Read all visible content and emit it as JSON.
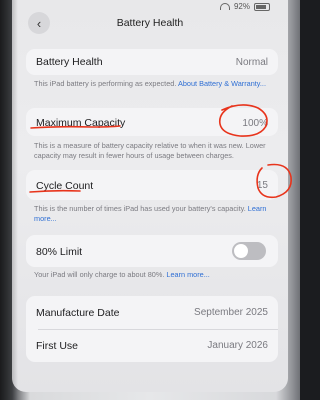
{
  "status": {
    "battery_text": "92%"
  },
  "nav": {
    "back_glyph": "‹",
    "title": "Battery Health"
  },
  "battery_health": {
    "label": "Battery Health",
    "value": "Normal",
    "note": "This iPad battery is performing as expected.",
    "link": "About Battery & Warranty..."
  },
  "max_capacity": {
    "label": "Maximum Capacity",
    "value": "100%",
    "note": "This is a measure of battery capacity relative to when it was new. Lower capacity may result in fewer hours of usage between charges."
  },
  "cycle_count": {
    "label": "Cycle Count",
    "value": "15",
    "note": "This is the number of times iPad has used your battery's capacity.",
    "link": "Learn more..."
  },
  "limit": {
    "label": "80% Limit",
    "enabled": false,
    "note": "Your iPad will only charge to about 80%.",
    "link": "Learn more..."
  },
  "dates": {
    "manufacture_label": "Manufacture Date",
    "manufacture_value": "September 2025",
    "first_use_label": "First Use",
    "first_use_value": "January 2026"
  },
  "colors": {
    "annotation": "#e8341c",
    "link": "#2f6fd4"
  }
}
